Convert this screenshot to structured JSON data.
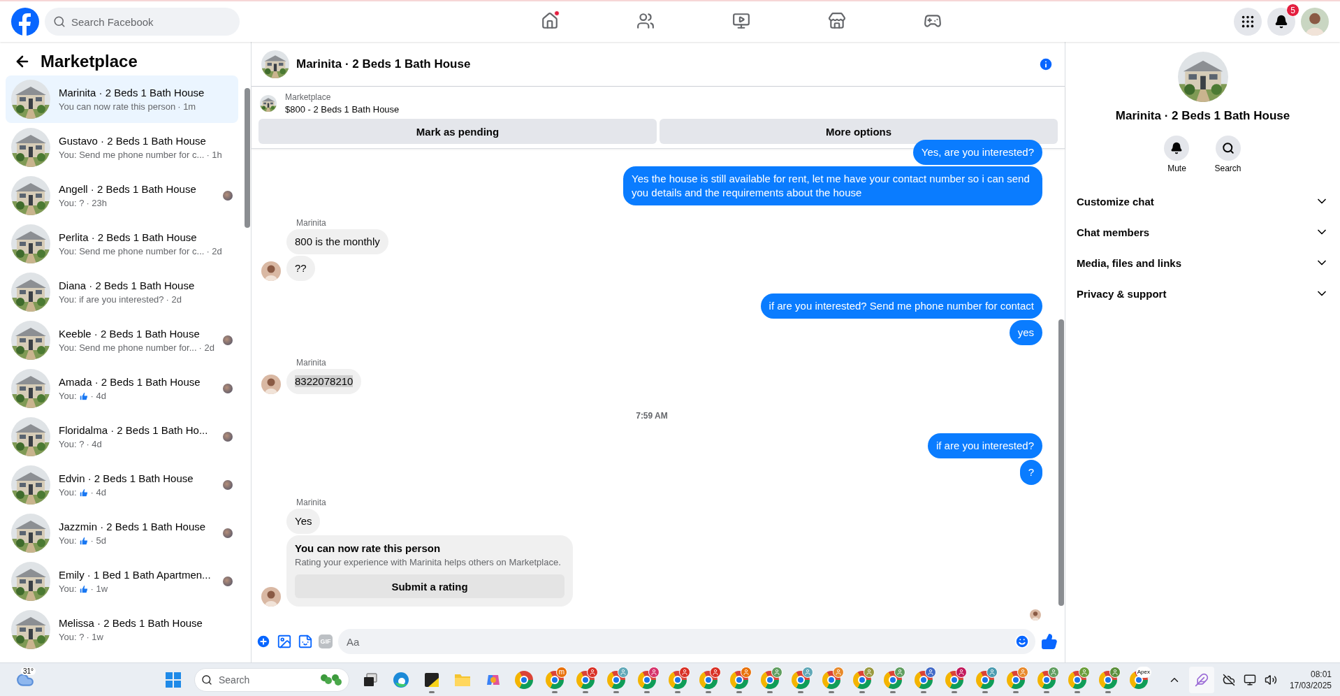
{
  "header": {
    "search": {
      "placeholder": "Search Facebook"
    },
    "nav": [
      {
        "selected": false,
        "dot": true
      },
      {
        "selected": false,
        "dot": false
      },
      {
        "selected": false,
        "dot": false
      },
      {
        "selected": false,
        "dot": false
      },
      {
        "selected": false,
        "dot": false
      }
    ],
    "notifications_badge": "5"
  },
  "sidebar": {
    "title": "Marketplace",
    "conversations": [
      {
        "name": "Marinita · 2 Beds 1 Bath House",
        "preview": "You can now rate this person",
        "like": false,
        "time": "· 1m",
        "selected": true,
        "seen": false
      },
      {
        "name": "Gustavo · 2 Beds 1 Bath House",
        "preview": "You: Send me phone number for c...",
        "like": false,
        "time": "· 1h",
        "selected": false,
        "seen": false
      },
      {
        "name": "Angell · 2 Beds 1 Bath House",
        "preview": "You: ?",
        "like": false,
        "time": "· 23h",
        "selected": false,
        "seen": true
      },
      {
        "name": "Perlita · 2 Beds 1 Bath House",
        "preview": "You: Send me phone number for c...",
        "like": false,
        "time": "· 2d",
        "selected": false,
        "seen": false
      },
      {
        "name": "Diana · 2 Beds 1 Bath House",
        "preview": "You: if are you interested?",
        "like": false,
        "time": "· 2d",
        "selected": false,
        "seen": false
      },
      {
        "name": "Keeble · 2 Beds 1 Bath House",
        "preview": "You: Send me phone number for...",
        "like": false,
        "time": "· 2d",
        "selected": false,
        "seen": true
      },
      {
        "name": "Amada · 2 Beds 1 Bath House",
        "preview": "You:",
        "like": true,
        "time": "· 4d",
        "selected": false,
        "seen": true
      },
      {
        "name": "Floridalma · 2 Beds 1 Bath Ho...",
        "preview": "You: ?",
        "like": false,
        "time": "· 4d",
        "selected": false,
        "seen": true
      },
      {
        "name": "Edvin · 2 Beds 1 Bath House",
        "preview": "You:",
        "like": true,
        "time": "· 4d",
        "selected": false,
        "seen": true
      },
      {
        "name": "Jazzmin · 2 Beds 1 Bath House",
        "preview": "You:",
        "like": true,
        "time": "· 5d",
        "selected": false,
        "seen": true
      },
      {
        "name": "Emily · 1 Bed 1 Bath Apartmen...",
        "preview": "You:",
        "like": true,
        "time": "· 1w",
        "selected": false,
        "seen": true
      },
      {
        "name": "Melissa · 2 Beds 1 Bath House",
        "preview": "You: ?",
        "like": false,
        "time": "· 1w",
        "selected": false,
        "seen": false
      }
    ]
  },
  "chat": {
    "title": "Marinita · 2 Beds 1 Bath House",
    "listing": {
      "label": "Marketplace",
      "title": "$800 - 2 Beds 1 Bath House"
    },
    "actions": [
      "Mark as pending",
      "More options"
    ],
    "messages": [
      {
        "kind": "outgoing",
        "text": "Yes, are you interested?"
      },
      {
        "kind": "outgoing",
        "text": "Yes the house is still available for rent, let me have your contact number so i can send you details and the requirements about the house"
      },
      {
        "kind": "sender",
        "text": "Marinita"
      },
      {
        "kind": "incoming",
        "text": "800 is the monthly",
        "avatar": false,
        "highlighted": false
      },
      {
        "kind": "incoming",
        "text": "??",
        "avatar": true,
        "highlighted": false
      },
      {
        "kind": "outgoing",
        "text": "if are you interested? Send me phone number for contact"
      },
      {
        "kind": "outgoing",
        "text": "yes"
      },
      {
        "kind": "sender",
        "text": "Marinita"
      },
      {
        "kind": "incoming",
        "text": "8322078210",
        "avatar": true,
        "highlighted": true
      },
      {
        "kind": "timestamp",
        "text": "7:59 AM"
      },
      {
        "kind": "outgoing",
        "text": "if are you interested?"
      },
      {
        "kind": "outgoing",
        "text": "?"
      },
      {
        "kind": "sender",
        "text": "Marinita"
      },
      {
        "kind": "incoming",
        "text": "Yes",
        "avatar": false,
        "highlighted": false
      },
      {
        "kind": "rating_card",
        "title": "You can now rate this person",
        "text": "Rating your experience with Marinita helps others on Marketplace.",
        "button": "Submit a rating",
        "avatar": true
      }
    ],
    "composer": {
      "gif": "GIF",
      "placeholder": "Aa"
    }
  },
  "details": {
    "name": "Marinita · 2 Beds 1 Bath House",
    "actions": [
      "Mute",
      "Search"
    ],
    "sections": [
      {
        "label": "Customize chat",
        "expanded": false
      },
      {
        "label": "Chat members",
        "expanded": false
      },
      {
        "label": "Media, files and links",
        "expanded": false
      },
      {
        "label": "Privacy & support",
        "expanded": false
      }
    ]
  },
  "taskbar": {
    "temperature": "31°",
    "search": {
      "placeholder": "Search"
    },
    "apps": [
      {
        "kind": "task-view",
        "running": false
      },
      {
        "kind": "edge",
        "running": false
      },
      {
        "kind": "notes",
        "running": true
      },
      {
        "kind": "folder",
        "running": false
      },
      {
        "kind": "copilot",
        "running": false
      },
      {
        "kind": "chrome",
        "running": false
      },
      {
        "kind": "chrome-profile",
        "running": true,
        "color": "#e8710a",
        "badge_text": "m"
      },
      {
        "kind": "chrome-profile",
        "running": true,
        "color": "#d93025"
      },
      {
        "kind": "chrome-profile",
        "running": true,
        "color": "#5fa8b8"
      },
      {
        "kind": "chrome-profile",
        "running": true,
        "color": "#d6336c"
      },
      {
        "kind": "chrome-profile",
        "running": true,
        "color": "#d93025"
      },
      {
        "kind": "chrome-profile",
        "running": true,
        "color": "#d93025"
      },
      {
        "kind": "chrome-profile",
        "running": true,
        "color": "#e8710a"
      },
      {
        "kind": "chrome-profile",
        "running": true,
        "color": "#5f9e5f"
      },
      {
        "kind": "chrome-profile",
        "running": true,
        "color": "#5fa8b8"
      },
      {
        "kind": "chrome-profile",
        "running": true,
        "color": "#e8892a"
      },
      {
        "kind": "chrome-profile",
        "running": true,
        "color": "#9a9a40"
      },
      {
        "kind": "chrome-profile",
        "running": true,
        "color": "#5f9e5f"
      },
      {
        "kind": "chrome-profile",
        "running": true,
        "color": "#4169c8"
      },
      {
        "kind": "chrome-profile",
        "running": true,
        "color": "#c2185b"
      },
      {
        "kind": "chrome-profile",
        "running": true,
        "color": "#4a9bb0"
      },
      {
        "kind": "chrome-profile",
        "running": true,
        "color": "#e8892a"
      },
      {
        "kind": "chrome-profile",
        "running": true,
        "color": "#5f9e5f"
      },
      {
        "kind": "chrome-profile",
        "running": true,
        "color": "#6a9e3a"
      },
      {
        "kind": "chrome-profile",
        "running": true,
        "color": "#5a8f3a"
      },
      {
        "kind": "chrome-profile",
        "running": false,
        "color": "#ffffff",
        "badge_text": "Apex"
      }
    ],
    "time": "08:01",
    "date": "17/03/2025"
  }
}
